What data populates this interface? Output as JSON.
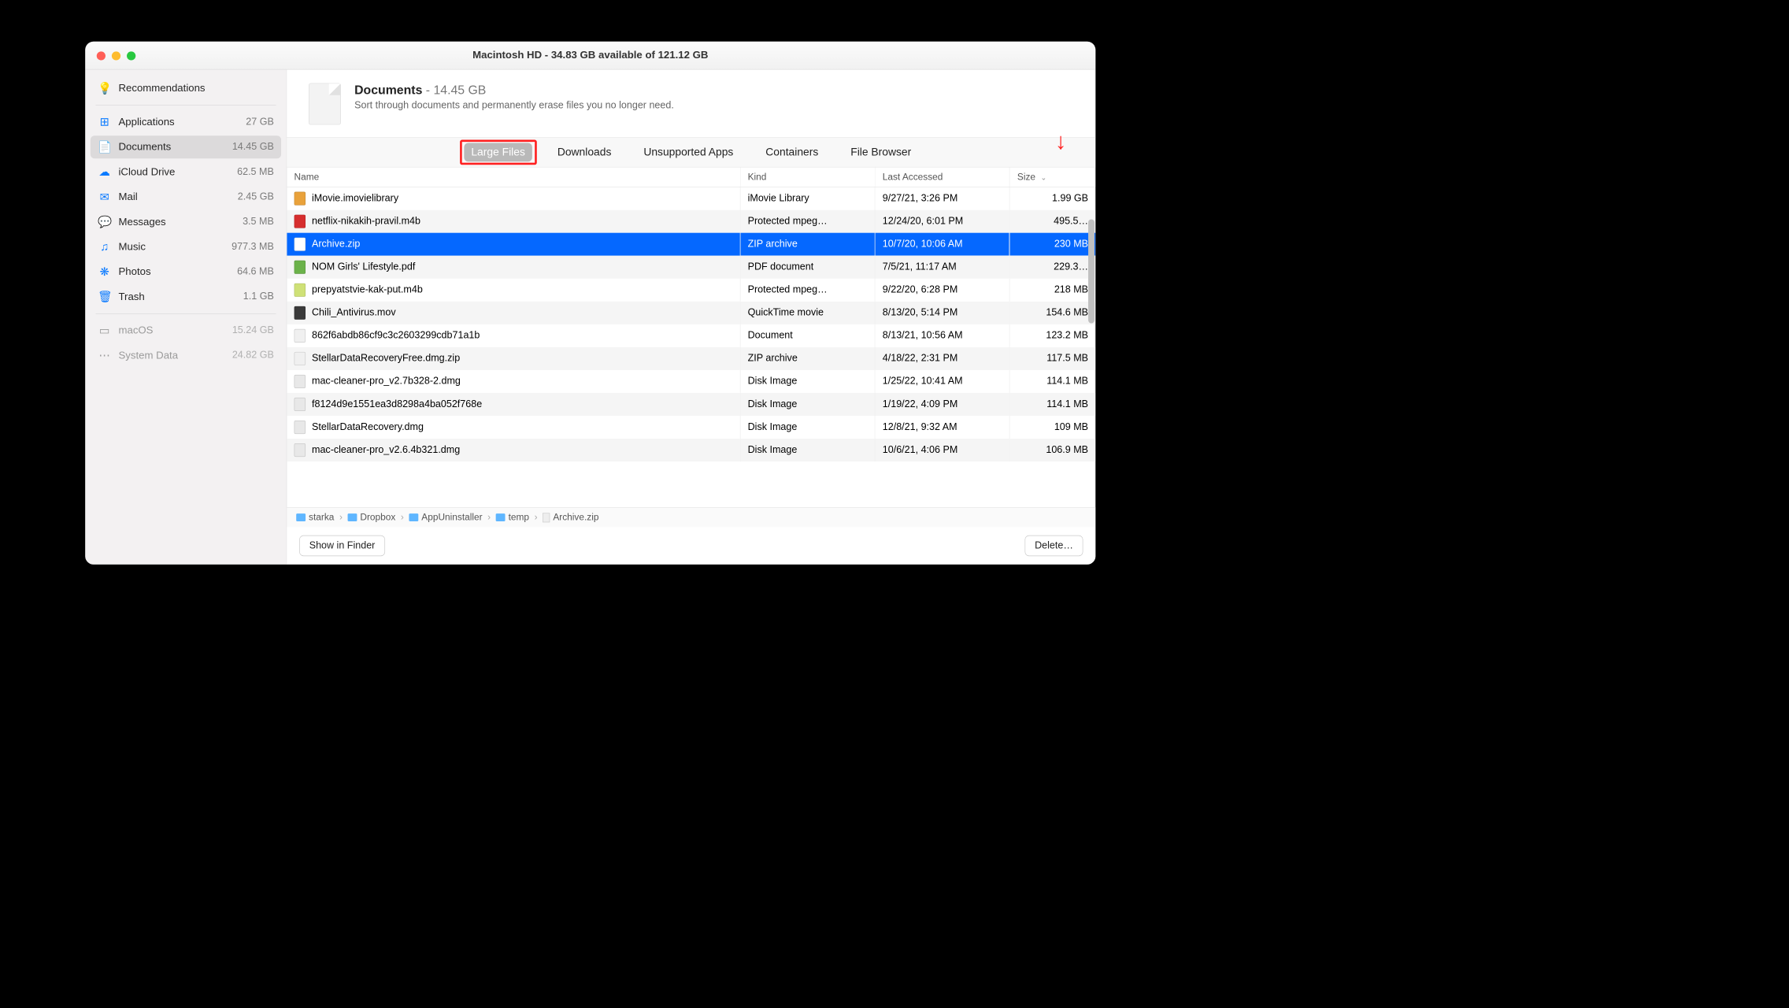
{
  "title": "Macintosh HD - 34.83 GB available of 121.12 GB",
  "header": {
    "title": "Documents",
    "size": " - 14.45 GB",
    "desc": "Sort through documents and permanently erase files you no longer need."
  },
  "sidebar": {
    "items": [
      {
        "icon": "💡",
        "label": "Recommendations",
        "meta": "",
        "class": "blue"
      },
      {
        "sep": true
      },
      {
        "icon": "⊞",
        "label": "Applications",
        "meta": "27 GB",
        "class": "blue"
      },
      {
        "icon": "📄",
        "label": "Documents",
        "meta": "14.45 GB",
        "selected": true,
        "class": "blue"
      },
      {
        "icon": "☁︎",
        "label": "iCloud Drive",
        "meta": "62.5 MB",
        "class": "blue"
      },
      {
        "icon": "✉︎",
        "label": "Mail",
        "meta": "2.45 GB",
        "class": "blue"
      },
      {
        "icon": "💬",
        "label": "Messages",
        "meta": "3.5 MB",
        "class": "blue"
      },
      {
        "icon": "♫",
        "label": "Music",
        "meta": "977.3 MB",
        "class": "blue"
      },
      {
        "icon": "❋",
        "label": "Photos",
        "meta": "64.6 MB",
        "class": "blue"
      },
      {
        "icon": "🗑",
        "label": "Trash",
        "meta": "1.1 GB",
        "class": "blue"
      },
      {
        "sep": true
      },
      {
        "icon": "▭",
        "label": "macOS",
        "meta": "15.24 GB",
        "dim": true
      },
      {
        "icon": "⋯",
        "label": "System Data",
        "meta": "24.82 GB",
        "dim": true
      }
    ]
  },
  "tabs": [
    "Large Files",
    "Downloads",
    "Unsupported Apps",
    "Containers",
    "File Browser"
  ],
  "active_tab": 0,
  "columns": [
    "Name",
    "Kind",
    "Last Accessed",
    "Size"
  ],
  "sort_col": 3,
  "rows": [
    {
      "icon": "#e9a23b",
      "name": "iMovie.imovielibrary",
      "kind": "iMovie Library",
      "date": "9/27/21, 3:26 PM",
      "size": "1.99 GB"
    },
    {
      "icon": "#d62e2e",
      "name": "netflix-nikakih-pravil.m4b",
      "kind": "Protected mpeg…",
      "date": "12/24/20, 6:01 PM",
      "size": "495.5…"
    },
    {
      "icon": "#ffffff",
      "name": "Archive.zip",
      "kind": "ZIP archive",
      "date": "10/7/20, 10:06 AM",
      "size": "230 MB",
      "sel": true
    },
    {
      "icon": "#6bb24a",
      "name": "NOM Girls' Lifestyle.pdf",
      "kind": "PDF document",
      "date": "7/5/21, 11:17 AM",
      "size": "229.3…"
    },
    {
      "icon": "#cfe177",
      "name": "prepyatstvie-kak-put.m4b",
      "kind": "Protected mpeg…",
      "date": "9/22/20, 6:28 PM",
      "size": "218 MB"
    },
    {
      "icon": "#3a3a3a",
      "name": "Chili_Antivirus.mov",
      "kind": "QuickTime movie",
      "date": "8/13/20, 5:14 PM",
      "size": "154.6 MB"
    },
    {
      "icon": "#f0f0f0",
      "name": "862f6abdb86cf9c3c2603299cdb71a1b",
      "kind": "Document",
      "date": "8/13/21, 10:56 AM",
      "size": "123.2 MB"
    },
    {
      "icon": "#f0f0f0",
      "name": "StellarDataRecoveryFree.dmg.zip",
      "kind": "ZIP archive",
      "date": "4/18/22, 2:31 PM",
      "size": "117.5 MB"
    },
    {
      "icon": "#e8e8e8",
      "name": "mac-cleaner-pro_v2.7b328-2.dmg",
      "kind": "Disk Image",
      "date": "1/25/22, 10:41 AM",
      "size": "114.1 MB"
    },
    {
      "icon": "#e8e8e8",
      "name": "f8124d9e1551ea3d8298a4ba052f768e",
      "kind": "Disk Image",
      "date": "1/19/22, 4:09 PM",
      "size": "114.1 MB"
    },
    {
      "icon": "#e8e8e8",
      "name": "StellarDataRecovery.dmg",
      "kind": "Disk Image",
      "date": "12/8/21, 9:32 AM",
      "size": "109 MB"
    },
    {
      "icon": "#e8e8e8",
      "name": "mac-cleaner-pro_v2.6.4b321.dmg",
      "kind": "Disk Image",
      "date": "10/6/21, 4:06 PM",
      "size": "106.9 MB"
    }
  ],
  "breadcrumb": [
    "starka",
    "Dropbox",
    "AppUninstaller",
    "temp",
    "Archive.zip"
  ],
  "buttons": {
    "show": "Show in Finder",
    "delete": "Delete…"
  }
}
